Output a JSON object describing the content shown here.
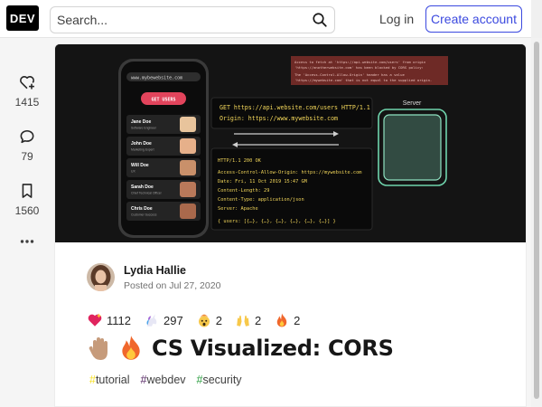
{
  "header": {
    "logo": "DEV",
    "search_placeholder": "Search...",
    "login_label": "Log in",
    "create_account_label": "Create account"
  },
  "sidebar": {
    "hearts": "1415",
    "comments": "79",
    "saves": "1560"
  },
  "cover": {
    "phone": {
      "url": "www.mybewebsite.com",
      "button": "GET USERS",
      "users": [
        {
          "name": "Jane Doe",
          "role": "Software Engineer"
        },
        {
          "name": "John Doe",
          "role": "Marketing Expert"
        },
        {
          "name": "Will Doe",
          "role": "UX"
        },
        {
          "name": "Sarah Doe",
          "role": "Chief Technical Officer"
        },
        {
          "name": "Chris Doe",
          "role": "Customer Success"
        }
      ]
    },
    "request": {
      "line1": "GET https://api.website.com/users HTTP/1.1",
      "line2": "Origin: https://www.mywebsite.com"
    },
    "response": {
      "l1": "HTTP/1.1 200 OK",
      "l2": "Access-Control-Allow-Origin: https://mywebsite.com",
      "l3": "Date: Fri, 11 Oct 2019 15:47 GM",
      "l4": "Content-Length: 29",
      "l5": "Content-Type: application/json",
      "l6": "Server: Apache",
      "l7": "{ users: [{…}, {…}, {…}, {…}, {…}, {…}] }"
    },
    "error": {
      "l1": "Access to fetch at 'https://api.website.com/users' from origin",
      "l2": "'https://anotherwebsite.com' has been blocked by CORS policy:",
      "l3": "The 'Access-Control-Allow-Origin' header has a value",
      "l4": "'https://mywebsite.com' that is not equal to the supplied origin."
    },
    "server_label": "Server"
  },
  "article": {
    "author_name": "Lydia Hallie",
    "posted": "Posted on Jul 27, 2020",
    "reactions": [
      {
        "icon": "sparkle-heart-icon",
        "count": "1112"
      },
      {
        "icon": "unicorn-icon",
        "count": "297"
      },
      {
        "icon": "exploding-head-icon",
        "count": "2"
      },
      {
        "icon": "raised-hands-icon",
        "count": "2"
      },
      {
        "icon": "fire-icon",
        "count": "2"
      }
    ],
    "title": "CS Visualized: CORS",
    "tags": [
      {
        "hash": "#",
        "name": "tutorial",
        "color": "#f7df1e"
      },
      {
        "hash": "#",
        "name": "webdev",
        "color": "#562765"
      },
      {
        "hash": "#",
        "name": "security",
        "color": "#2a9d3f"
      }
    ]
  }
}
